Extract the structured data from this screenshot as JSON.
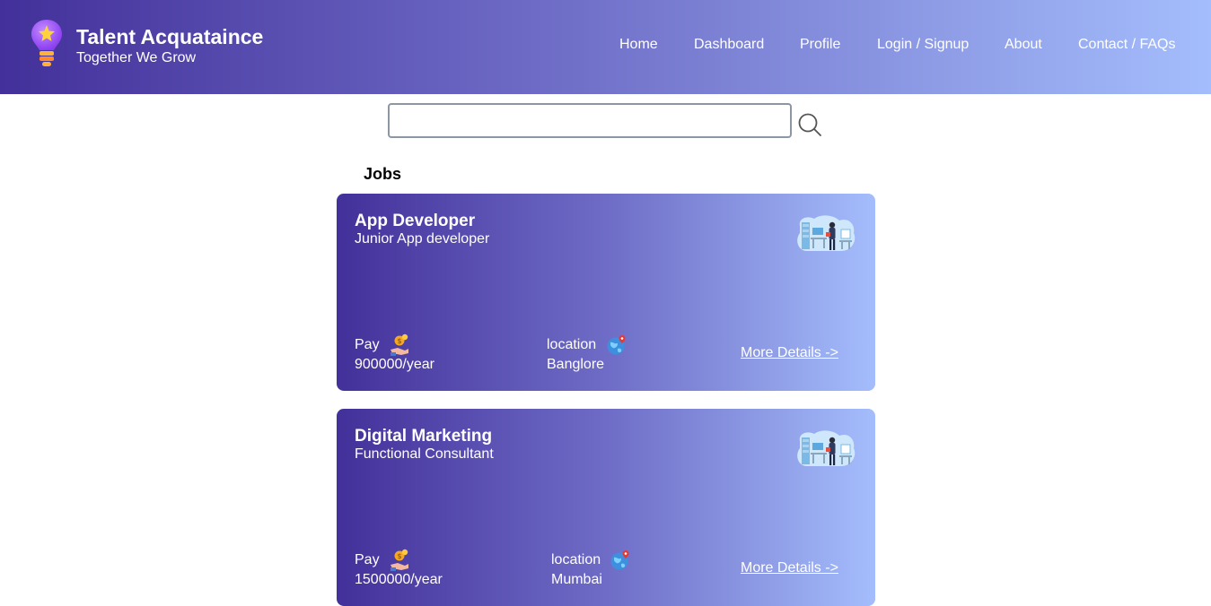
{
  "brand": {
    "title": "Talent Acquataince",
    "tagline": "Together We Grow",
    "logo_icon": "lightbulb-star-icon"
  },
  "nav": [
    {
      "label": "Home"
    },
    {
      "label": "Dashboard"
    },
    {
      "label": "Profile"
    },
    {
      "label": "Login / Signup"
    },
    {
      "label": "About"
    },
    {
      "label": "Contact / FAQs"
    }
  ],
  "search": {
    "value": "",
    "placeholder": "",
    "icon": "search-icon"
  },
  "jobs_section": {
    "title": "Jobs",
    "items": [
      {
        "title": "App Developer",
        "subtitle": "Junior App developer",
        "pay_label": "Pay",
        "pay_value": "900000/year",
        "location_label": "location",
        "location_value": "Banglore",
        "link_label": "More Details ->"
      },
      {
        "title": "Digital Marketing",
        "subtitle": "Functional Consultant",
        "pay_label": "Pay",
        "pay_value": "1500000/year",
        "location_label": "location",
        "location_value": "Mumbai",
        "link_label": "More Details ->"
      }
    ]
  },
  "colors": {
    "gradient_start": "#43309a",
    "gradient_mid": "#6e6cc6",
    "gradient_end": "#a4bdfc",
    "text_on_gradient": "#ffffff"
  }
}
